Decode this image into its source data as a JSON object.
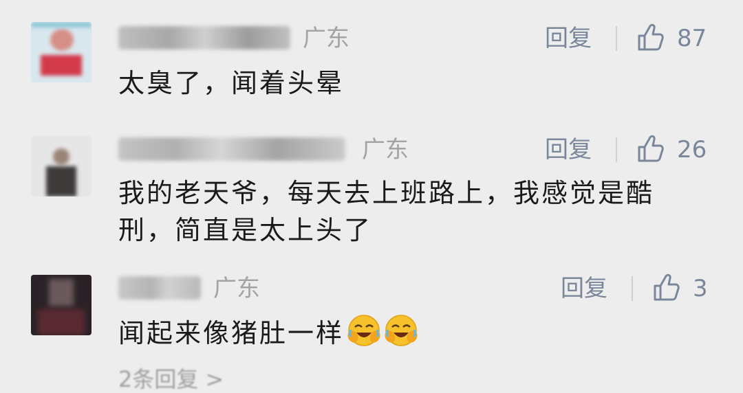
{
  "comments": [
    {
      "region": "广东",
      "reply_label": "回复",
      "likes": "87",
      "text": "太臭了，闻着头晕",
      "avatar": "avatar-icon"
    },
    {
      "region": "广东",
      "reply_label": "回复",
      "likes": "26",
      "text": "我的老天爷，每天去上班路上，我感觉是酷刑，简直是太上头了",
      "avatar": "avatar-icon"
    },
    {
      "region": "广东",
      "reply_label": "回复",
      "likes": "3",
      "text": "闻起来像猪肚一样",
      "avatar": "avatar-icon",
      "emojis": [
        "crying-laughing-face-icon",
        "crying-laughing-face-icon"
      ]
    }
  ],
  "more_replies": "2条回复 >",
  "colors": {
    "background": "#ededed",
    "reply": "#7a869a",
    "region": "#a3a3a3",
    "text": "#1a1a1a"
  }
}
